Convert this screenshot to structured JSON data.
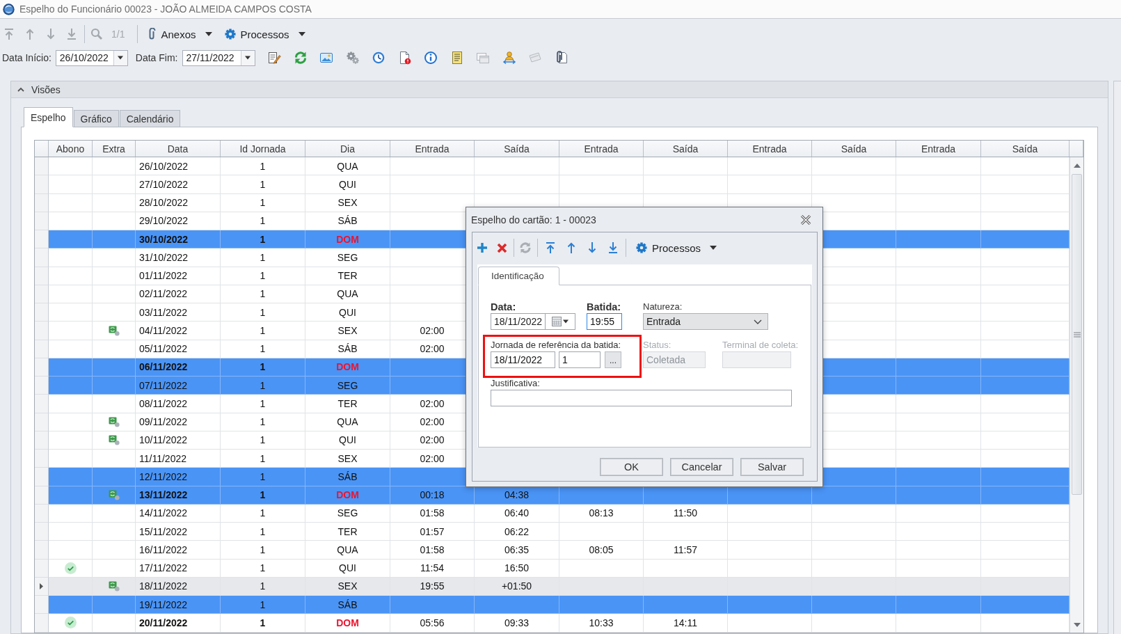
{
  "window": {
    "title": "Espelho do Funcionário 00023 - JOÃO ALMEIDA CAMPOS COSTA"
  },
  "toolbar": {
    "navigation_disabled": true,
    "record_counter": "1/1",
    "menus": [
      "Anexos",
      "Processos"
    ]
  },
  "filters": [
    {
      "label": "Data Início:",
      "value": "26/10/2022"
    },
    {
      "label": "Data Fim:",
      "value": "27/11/2022"
    }
  ],
  "panel": {
    "title": "Visões",
    "expanded": true
  },
  "tabs": [
    {
      "label": "Espelho",
      "selected": true
    },
    {
      "label": "Gráfico",
      "selected": false
    },
    {
      "label": "Calendário",
      "selected": false
    }
  ],
  "table": {
    "columns": [
      "Abono",
      "Extra",
      "Data",
      "Id Jornada",
      "Dia",
      "Entrada",
      "Saída",
      "Entrada",
      "Saída",
      "Entrada",
      "Saída",
      "Entrada",
      "Saída"
    ],
    "rows": [
      {
        "data": "26/10/2022",
        "id_jornada": "1",
        "dia": "QUA",
        "abono": false,
        "extra": false,
        "highlighted": false,
        "bold": false,
        "selected": false
      },
      {
        "data": "27/10/2022",
        "id_jornada": "1",
        "dia": "QUI",
        "abono": false,
        "extra": false,
        "highlighted": false,
        "bold": false,
        "selected": false
      },
      {
        "data": "28/10/2022",
        "id_jornada": "1",
        "dia": "SEX",
        "abono": false,
        "extra": false,
        "highlighted": false,
        "bold": false,
        "selected": false
      },
      {
        "data": "29/10/2022",
        "id_jornada": "1",
        "dia": "SÁB",
        "abono": false,
        "extra": false,
        "highlighted": false,
        "bold": false,
        "selected": false
      },
      {
        "data": "30/10/2022",
        "id_jornada": "1",
        "dia": "DOM",
        "abono": false,
        "extra": false,
        "highlighted": true,
        "bold": true,
        "selected": false
      },
      {
        "data": "31/10/2022",
        "id_jornada": "1",
        "dia": "SEG",
        "abono": false,
        "extra": false,
        "highlighted": false,
        "bold": false,
        "selected": false
      },
      {
        "data": "01/11/2022",
        "id_jornada": "1",
        "dia": "TER",
        "abono": false,
        "extra": false,
        "highlighted": false,
        "bold": false,
        "selected": false
      },
      {
        "data": "02/11/2022",
        "id_jornada": "1",
        "dia": "QUA",
        "abono": false,
        "extra": false,
        "highlighted": false,
        "bold": false,
        "selected": false
      },
      {
        "data": "03/11/2022",
        "id_jornada": "1",
        "dia": "QUI",
        "abono": false,
        "extra": false,
        "highlighted": false,
        "bold": false,
        "selected": false
      },
      {
        "data": "04/11/2022",
        "id_jornada": "1",
        "dia": "SEX",
        "times": [
          "02:00"
        ],
        "abono": false,
        "extra": true,
        "highlighted": false,
        "bold": false,
        "selected": false
      },
      {
        "data": "05/11/2022",
        "id_jornada": "1",
        "dia": "SÁB",
        "times": [
          "02:00"
        ],
        "abono": false,
        "extra": false,
        "highlighted": false,
        "bold": false,
        "selected": false
      },
      {
        "data": "06/11/2022",
        "id_jornada": "1",
        "dia": "DOM",
        "abono": false,
        "extra": false,
        "highlighted": true,
        "bold": true,
        "selected": false
      },
      {
        "data": "07/11/2022",
        "id_jornada": "1",
        "dia": "SEG",
        "abono": false,
        "extra": false,
        "highlighted": true,
        "bold": false,
        "selected": false
      },
      {
        "data": "08/11/2022",
        "id_jornada": "1",
        "dia": "TER",
        "times": [
          "02:00"
        ],
        "abono": false,
        "extra": false,
        "highlighted": false,
        "bold": false,
        "selected": false
      },
      {
        "data": "09/11/2022",
        "id_jornada": "1",
        "dia": "QUA",
        "times": [
          "02:00"
        ],
        "abono": false,
        "extra": true,
        "highlighted": false,
        "bold": false,
        "selected": false
      },
      {
        "data": "10/11/2022",
        "id_jornada": "1",
        "dia": "QUI",
        "times": [
          "02:00"
        ],
        "abono": false,
        "extra": true,
        "highlighted": false,
        "bold": false,
        "selected": false
      },
      {
        "data": "11/11/2022",
        "id_jornada": "1",
        "dia": "SEX",
        "times": [
          "02:00"
        ],
        "abono": false,
        "extra": false,
        "highlighted": false,
        "bold": false,
        "selected": false
      },
      {
        "data": "12/11/2022",
        "id_jornada": "1",
        "dia": "SÁB",
        "abono": false,
        "extra": false,
        "highlighted": true,
        "bold": false,
        "selected": false
      },
      {
        "data": "13/11/2022",
        "id_jornada": "1",
        "dia": "DOM",
        "times": [
          "00:18",
          "04:38"
        ],
        "abono": false,
        "extra": true,
        "highlighted": true,
        "bold": true,
        "selected": false
      },
      {
        "data": "14/11/2022",
        "id_jornada": "1",
        "dia": "SEG",
        "times": [
          "01:58",
          "06:40",
          "08:13",
          "11:50"
        ],
        "abono": false,
        "extra": false,
        "highlighted": false,
        "bold": false,
        "selected": false
      },
      {
        "data": "15/11/2022",
        "id_jornada": "1",
        "dia": "TER",
        "times": [
          "01:57",
          "06:22"
        ],
        "abono": false,
        "extra": false,
        "highlighted": false,
        "bold": false,
        "selected": false
      },
      {
        "data": "16/11/2022",
        "id_jornada": "1",
        "dia": "QUA",
        "times": [
          "01:58",
          "06:35",
          "08:05",
          "11:57"
        ],
        "abono": false,
        "extra": false,
        "highlighted": false,
        "bold": false,
        "selected": false
      },
      {
        "data": "17/11/2022",
        "id_jornada": "1",
        "dia": "QUI",
        "times": [
          "11:54",
          "16:50"
        ],
        "abono": true,
        "extra": false,
        "highlighted": false,
        "bold": false,
        "selected": false
      },
      {
        "data": "18/11/2022",
        "id_jornada": "1",
        "dia": "SEX",
        "times": [
          "19:55",
          "+01:50"
        ],
        "abono": false,
        "extra": true,
        "highlighted": false,
        "bold": false,
        "selected": true
      },
      {
        "data": "19/11/2022",
        "id_jornada": "1",
        "dia": "SÁB",
        "abono": false,
        "extra": false,
        "highlighted": true,
        "bold": false,
        "selected": false
      },
      {
        "data": "20/11/2022",
        "id_jornada": "1",
        "dia": "DOM",
        "times": [
          "05:56",
          "09:33",
          "10:33",
          "14:11"
        ],
        "abono": true,
        "extra": false,
        "highlighted": false,
        "bold": true,
        "selected": false
      }
    ]
  },
  "dialog": {
    "title": "Espelho do cartão: 1 - 00023",
    "toolbar": {
      "navigation_disabled": false,
      "refresh_disabled": true,
      "menu": "Processos"
    },
    "tabs": [
      {
        "label": "Identificação",
        "selected": true
      }
    ],
    "data": {
      "label": "Data:",
      "value": "18/11/2022"
    },
    "batida": {
      "label": "Batida:",
      "value": "19:55",
      "focused": true
    },
    "natureza": {
      "label": "Natureza:",
      "value": "Entrada"
    },
    "jornada": {
      "label": "Jornada de referência da batida:",
      "date": "18/11/2022",
      "id": "1",
      "button": "...",
      "highlighted": true
    },
    "status": {
      "label": "Status:",
      "value": "Coletada",
      "disabled": true
    },
    "terminal": {
      "label": "Terminal de coleta:",
      "disabled": true
    },
    "justificativa": {
      "label": "Justificativa:"
    },
    "buttons": [
      "OK",
      "Cancelar",
      "Salvar"
    ]
  }
}
